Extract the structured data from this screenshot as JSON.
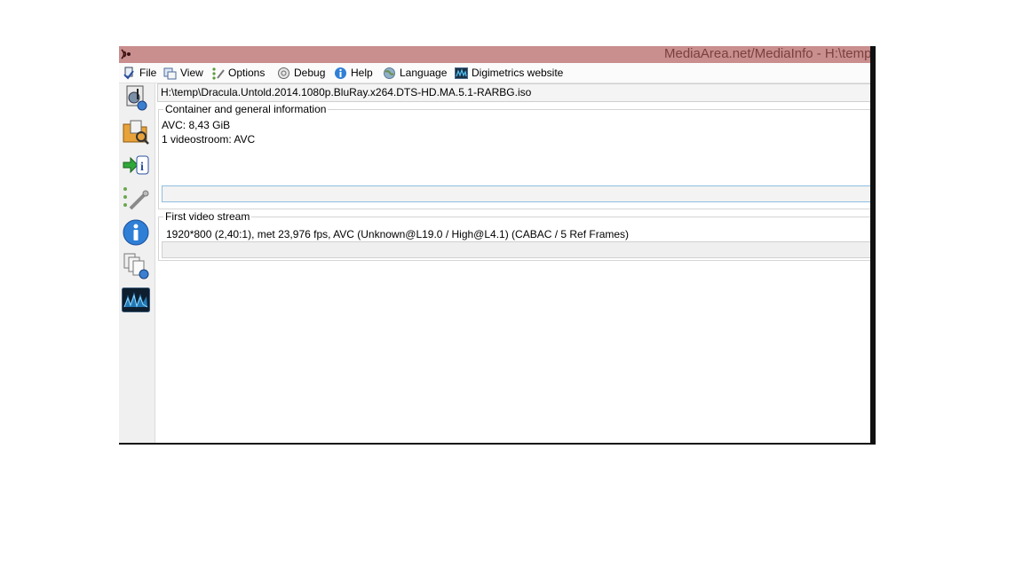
{
  "window": {
    "title": "MediaArea.net/MediaInfo - H:\\temp",
    "app_icon": "mediainfo-app-icon"
  },
  "menu": [
    {
      "label": "File",
      "icon": "file-menu-icon"
    },
    {
      "label": "View",
      "icon": "view-menu-icon"
    },
    {
      "label": "Options",
      "icon": "options-menu-icon"
    },
    {
      "label": "Debug",
      "icon": "debug-menu-icon"
    },
    {
      "label": "Help",
      "icon": "help-menu-icon"
    },
    {
      "label": "Language",
      "icon": "language-globe-icon"
    },
    {
      "label": "Digimetrics website",
      "icon": "digimetrics-icon"
    }
  ],
  "sidebar": [
    {
      "icon": "open-file-icon"
    },
    {
      "icon": "open-folder-icon"
    },
    {
      "icon": "export-info-icon"
    },
    {
      "icon": "preferences-tools-icon"
    },
    {
      "icon": "about-info-icon"
    },
    {
      "icon": "web-documents-icon"
    },
    {
      "icon": "digimetrics-waveform-icon"
    }
  ],
  "file_path": "H:\\temp\\Dracula.Untold.2014.1080p.BluRay.x264.DTS-HD.MA.5.1-RARBG.iso",
  "general": {
    "title": "Container and general information",
    "line1": "AVC: 8,43 GiB",
    "line2": "1 videostroom: AVC"
  },
  "video": {
    "title": "First video stream",
    "line1": "1920*800 (2,40:1), met 23,976 fps, AVC (Unknown@L19.0 / High@L4.1) (CABAC / 5 Ref Frames)"
  },
  "colors": {
    "titlebar": "#c98e8e",
    "general_field_border": "#8fbde0"
  }
}
